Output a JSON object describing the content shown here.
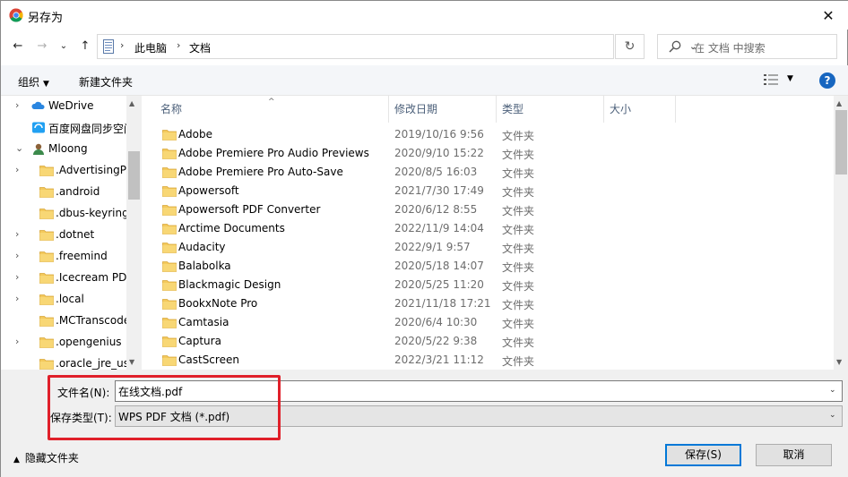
{
  "window": {
    "title": "另存为",
    "close_glyph": "✕"
  },
  "nav": {
    "back": "←",
    "forward": "→",
    "dropdown": "⌄",
    "up": "↑"
  },
  "address": {
    "crumbs": [
      "此电脑",
      "文档"
    ],
    "sep": "›",
    "dropdown": "⌄"
  },
  "refresh": "↻",
  "search": {
    "placeholder": "在 文档 中搜索"
  },
  "toolbar": {
    "organize": "组织",
    "organize_caret": "▼",
    "new_folder": "新建文件夹",
    "view_caret": "▼",
    "help": "?"
  },
  "tree": [
    {
      "label": "WeDrive",
      "chevron": "›",
      "icon": "wedrive-icon"
    },
    {
      "label": "百度网盘同步空间",
      "chevron": "",
      "icon": "baidu-icon"
    },
    {
      "label": "Mloong",
      "chevron": "⌄",
      "icon": "user-icon"
    },
    {
      "label": ".AdvertisingPortal",
      "chevron": "›",
      "icon": "folder-icon"
    },
    {
      "label": ".android",
      "chevron": "",
      "icon": "folder-icon"
    },
    {
      "label": ".dbus-keyrings",
      "chevron": "",
      "icon": "folder-icon"
    },
    {
      "label": ".dotnet",
      "chevron": "›",
      "icon": "folder-icon"
    },
    {
      "label": ".freemind",
      "chevron": "›",
      "icon": "folder-icon"
    },
    {
      "label": ".Icecream PDF",
      "chevron": "›",
      "icon": "folder-icon"
    },
    {
      "label": ".local",
      "chevron": "›",
      "icon": "folder-icon"
    },
    {
      "label": ".MCTranscoder",
      "chevron": "",
      "icon": "folder-icon"
    },
    {
      "label": ".opengenius",
      "chevron": "›",
      "icon": "folder-icon"
    },
    {
      "label": ".oracle_jre_usage",
      "chevron": "",
      "icon": "folder-icon"
    }
  ],
  "columns": {
    "name": "名称",
    "modified": "修改日期",
    "type": "类型",
    "size": "大小",
    "sort_indicator": "^"
  },
  "files": [
    {
      "name": "Adobe",
      "modified": "2019/10/16 9:56",
      "type": "文件夹"
    },
    {
      "name": "Adobe Premiere Pro Audio Previews",
      "modified": "2020/9/10 15:22",
      "type": "文件夹"
    },
    {
      "name": "Adobe Premiere Pro Auto-Save",
      "modified": "2020/8/5 16:03",
      "type": "文件夹"
    },
    {
      "name": "Apowersoft",
      "modified": "2021/7/30 17:49",
      "type": "文件夹"
    },
    {
      "name": "Apowersoft PDF Converter",
      "modified": "2020/6/12 8:55",
      "type": "文件夹"
    },
    {
      "name": "Arctime Documents",
      "modified": "2022/11/9 14:04",
      "type": "文件夹"
    },
    {
      "name": "Audacity",
      "modified": "2022/9/1 9:57",
      "type": "文件夹"
    },
    {
      "name": "Balabolka",
      "modified": "2020/5/18 14:07",
      "type": "文件夹"
    },
    {
      "name": "Blackmagic Design",
      "modified": "2020/5/25 11:20",
      "type": "文件夹"
    },
    {
      "name": "BookxNote Pro",
      "modified": "2021/11/18 17:21",
      "type": "文件夹"
    },
    {
      "name": "Camtasia",
      "modified": "2020/6/4 10:30",
      "type": "文件夹"
    },
    {
      "name": "Captura",
      "modified": "2020/5/22 9:38",
      "type": "文件夹"
    },
    {
      "name": "CastScreen",
      "modified": "2022/3/21 11:12",
      "type": "文件夹"
    }
  ],
  "scroll_arrows": {
    "up": "▲",
    "down": "▼"
  },
  "form": {
    "filename_label": "文件名(N):",
    "filename_value": "在线文档.pdf",
    "filetype_label": "保存类型(T):",
    "filetype_value": "WPS PDF 文档 (*.pdf)",
    "dropdown": "⌄"
  },
  "footer": {
    "hide_folders": "隐藏文件夹",
    "hide_caret": "▲",
    "save": "保存(S)",
    "cancel": "取消"
  },
  "colors": {
    "accent": "#0078d7",
    "highlight_box": "#e0202a",
    "folder": "#f3c95c",
    "help": "#1766c0"
  }
}
